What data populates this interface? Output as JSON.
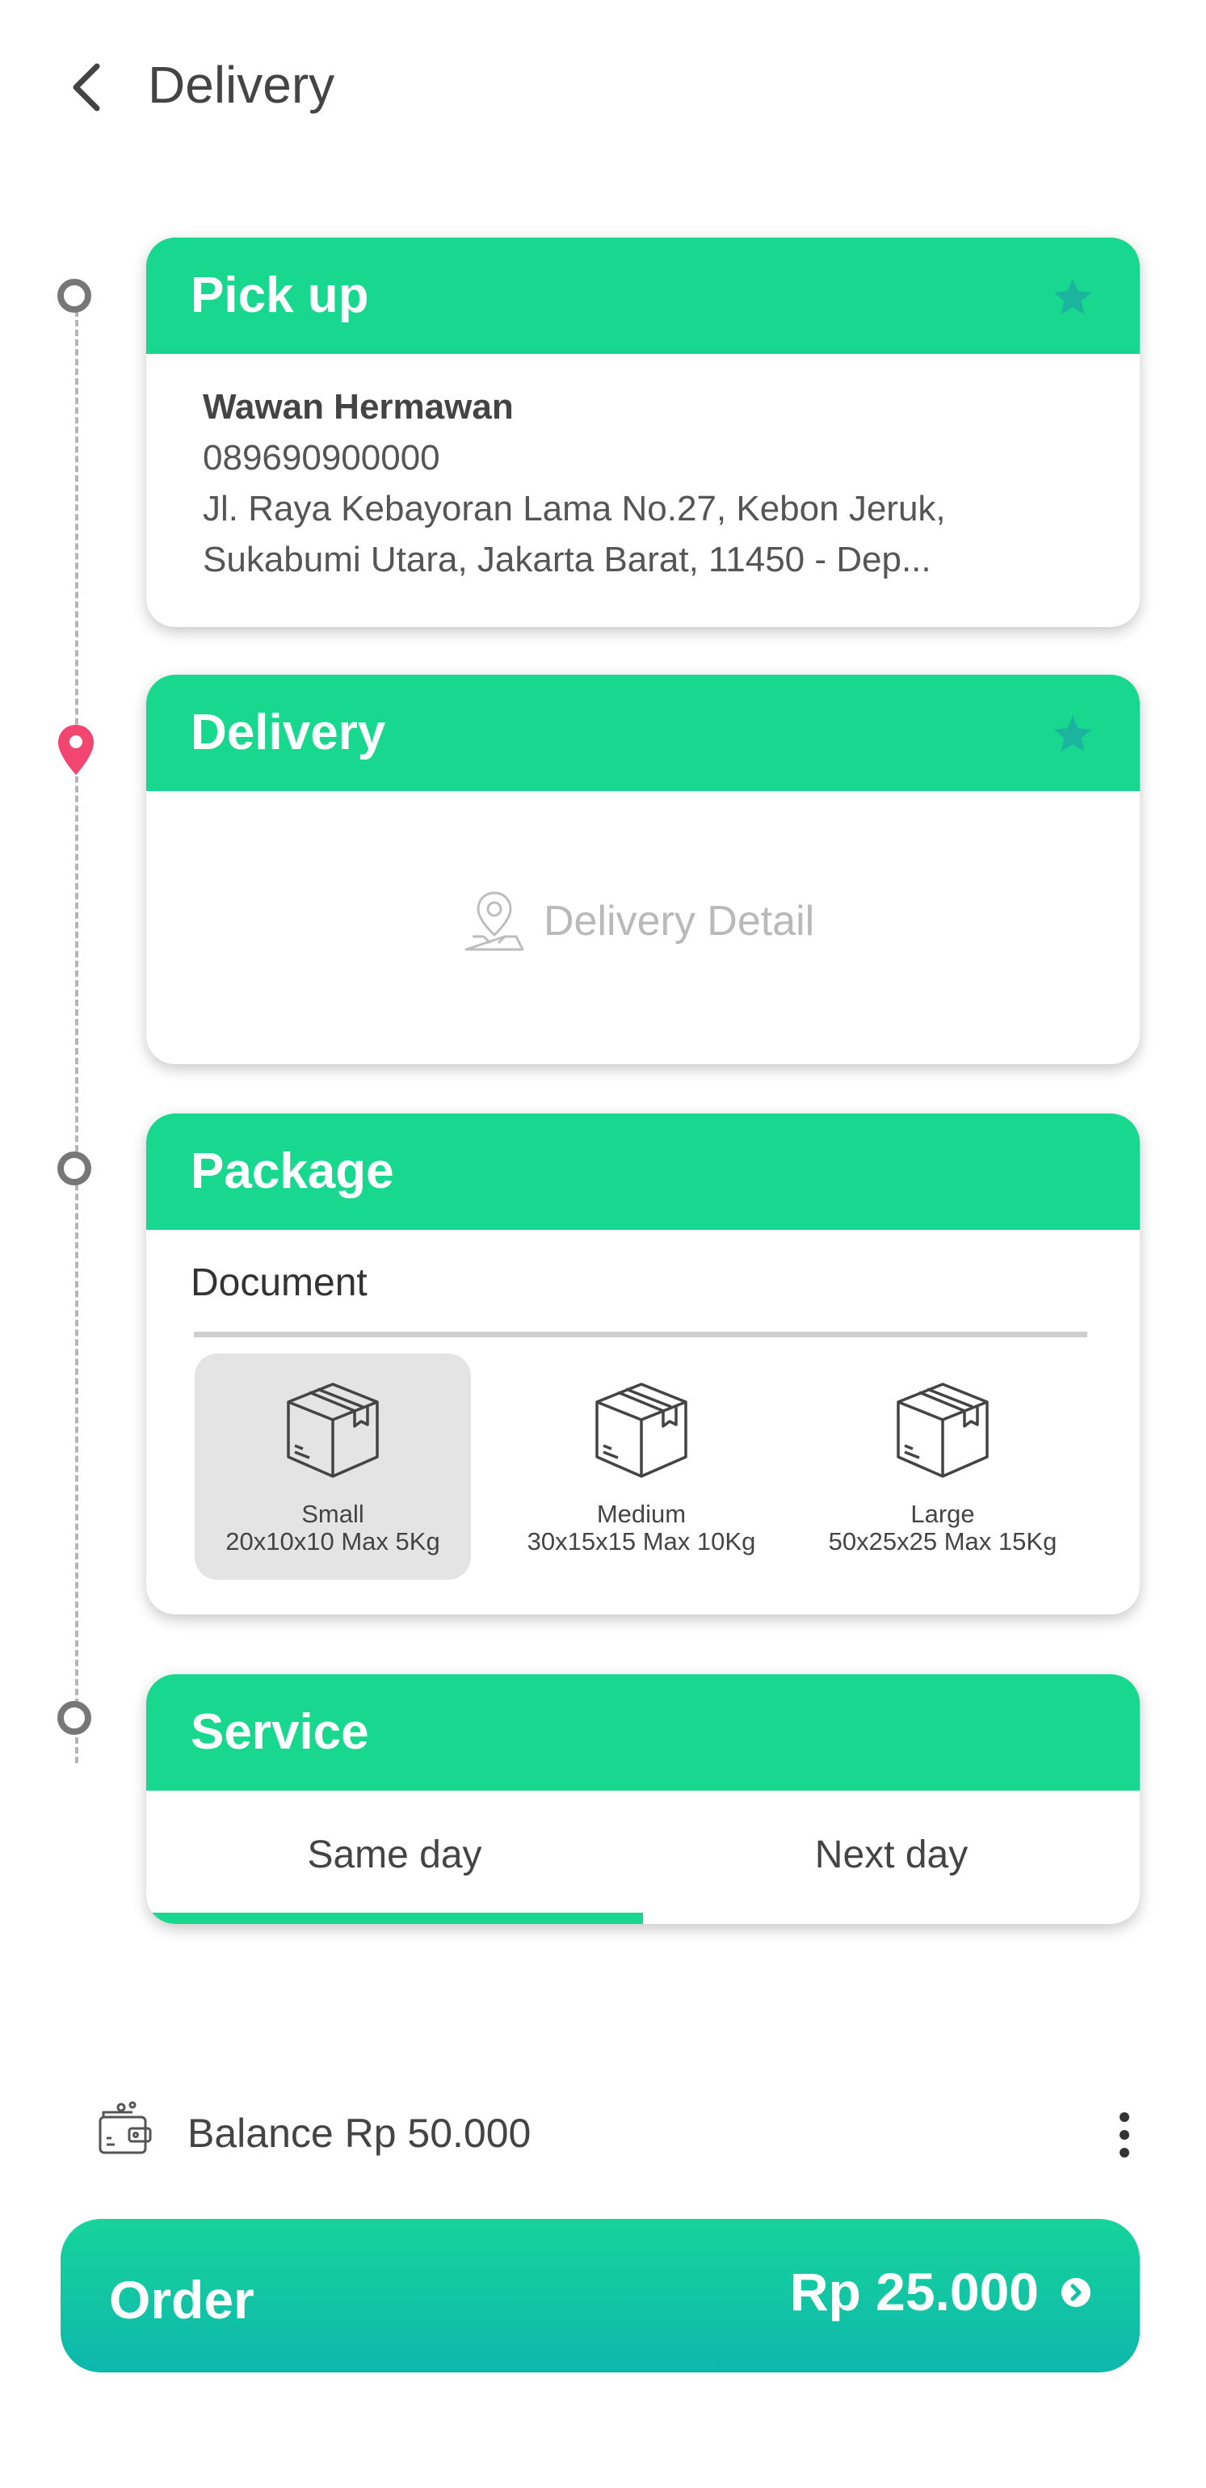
{
  "header": {
    "title": "Delivery",
    "back_icon": "chevron-left-icon"
  },
  "colors": {
    "accent": "#18d88f",
    "pin": "#f2456f",
    "star": "#1bb59f",
    "button_top": "#16d49a",
    "button_bottom": "#0eb7ad"
  },
  "pickup": {
    "title": "Pick up",
    "name": "Wawan Hermawan",
    "phone": "089690900000",
    "address_line1": "Jl. Raya Kebayoran Lama No.27, Kebon Jeruk,",
    "address_line2": "Sukabumi Utara, Jakarta Barat, 11450 - Dep..."
  },
  "delivery": {
    "title": "Delivery",
    "detail_label": "Delivery Detail"
  },
  "package": {
    "title": "Package",
    "input_value": "Document",
    "options": [
      {
        "name": "Small",
        "size": "20x10x10 Max 5Kg",
        "selected": true
      },
      {
        "name": "Medium",
        "size": "30x15x15 Max 10Kg",
        "selected": false
      },
      {
        "name": "Large",
        "size": "50x25x25 Max 15Kg",
        "selected": false
      }
    ]
  },
  "service": {
    "title": "Service",
    "tabs": [
      {
        "label": "Same day",
        "active": true
      },
      {
        "label": "Next day",
        "active": false
      }
    ]
  },
  "balance": {
    "text": "Balance Rp 50.000"
  },
  "order": {
    "label": "Order",
    "price": "Rp 25.000"
  }
}
